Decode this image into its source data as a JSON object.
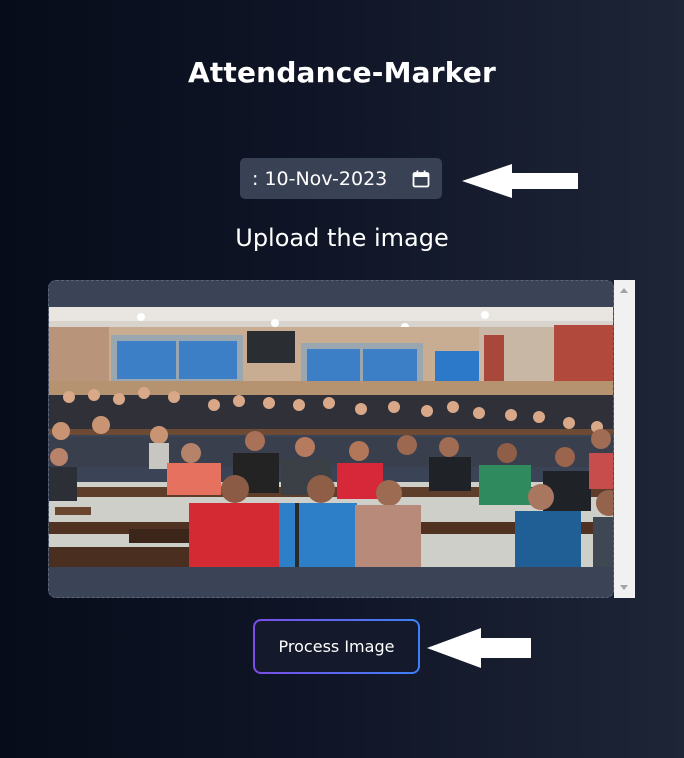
{
  "header": {
    "title": "Attendance-Marker"
  },
  "date_field": {
    "value": ": 10-Nov-2023",
    "icon": "calendar-icon"
  },
  "upload": {
    "label": "Upload the image"
  },
  "preview": {
    "description_icon": "classroom-photo"
  },
  "process_button": {
    "label": "Process Image"
  },
  "colors": {
    "background_left": "#070c1a",
    "background_right": "#1e2536",
    "input_bg": "#394255",
    "dropzone_bg": "#3b4356",
    "button_gradient_start": "#7c4de8",
    "button_gradient_end": "#3b82f6"
  }
}
